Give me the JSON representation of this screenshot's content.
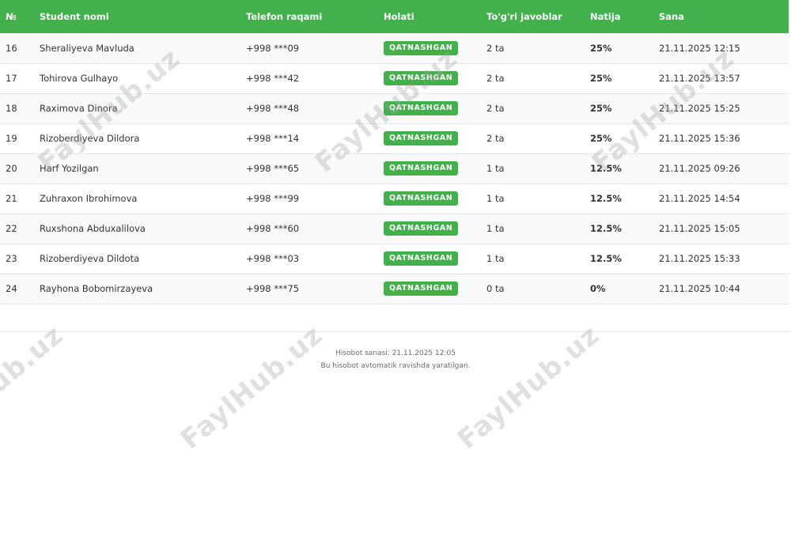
{
  "table": {
    "headers": {
      "num": "№",
      "name": "Student nomi",
      "phone": "Telefon raqami",
      "status": "Holati",
      "correct": "To'g'ri javoblar",
      "result": "Natija",
      "date": "Sana"
    },
    "rows": [
      {
        "num": "16",
        "name": "Sheraliyeva Mavluda",
        "phone": "+998 ***09",
        "status": "QATNASHGAN",
        "correct": "2 ta",
        "result": "25%",
        "date": "21.11.2025 12:15"
      },
      {
        "num": "17",
        "name": "Tohirova Gulhayo",
        "phone": "+998 ***42",
        "status": "QATNASHGAN",
        "correct": "2 ta",
        "result": "25%",
        "date": "21.11.2025 13:57"
      },
      {
        "num": "18",
        "name": "Raximova Dinora",
        "phone": "+998 ***48",
        "status": "QATNASHGAN",
        "correct": "2 ta",
        "result": "25%",
        "date": "21.11.2025 15:25"
      },
      {
        "num": "19",
        "name": "Rizoberdiyeva Dildora",
        "phone": "+998 ***14",
        "status": "QATNASHGAN",
        "correct": "2 ta",
        "result": "25%",
        "date": "21.11.2025 15:36"
      },
      {
        "num": "20",
        "name": "Harf Yozilgan",
        "phone": "+998 ***65",
        "status": "QATNASHGAN",
        "correct": "1 ta",
        "result": "12.5%",
        "date": "21.11.2025 09:26"
      },
      {
        "num": "21",
        "name": "Zuhraxon Ibrohimova",
        "phone": "+998 ***99",
        "status": "QATNASHGAN",
        "correct": "1 ta",
        "result": "12.5%",
        "date": "21.11.2025 14:54"
      },
      {
        "num": "22",
        "name": "Ruxshona Abduxalilova",
        "phone": "+998 ***60",
        "status": "QATNASHGAN",
        "correct": "1 ta",
        "result": "12.5%",
        "date": "21.11.2025 15:05"
      },
      {
        "num": "23",
        "name": "Rizoberdiyeva Dildota",
        "phone": "+998 ***03",
        "status": "QATNASHGAN",
        "correct": "1 ta",
        "result": "12.5%",
        "date": "21.11.2025 15:33"
      },
      {
        "num": "24",
        "name": "Rayhona Bobomirzayeva",
        "phone": "+998 ***75",
        "status": "QATNASHGAN",
        "correct": "0 ta",
        "result": "0%",
        "date": "21.11.2025 10:44"
      }
    ]
  },
  "footer": {
    "report_date": "Hisobot sanasi: 21.11.2025 12:05",
    "note": "Bu hisobot avtomatik ravishda yaratilgan."
  },
  "watermark": "FaylHub.uz",
  "colors": {
    "header_bg": "#43b14b",
    "badge_bg": "#43b14b",
    "result_text": "#c62828"
  }
}
